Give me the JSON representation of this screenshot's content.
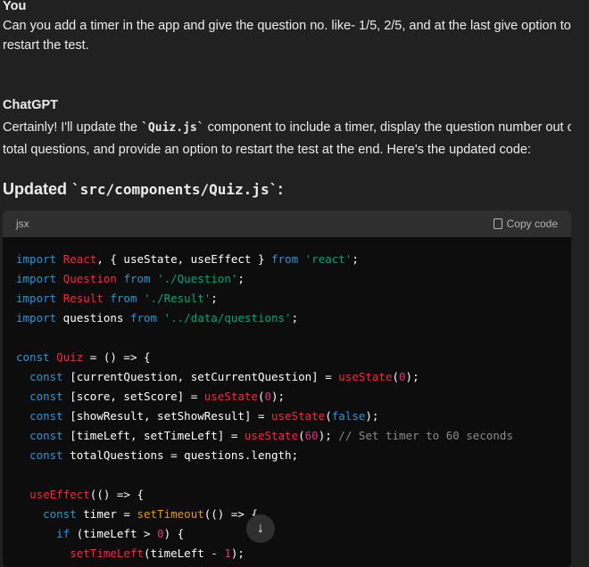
{
  "user": {
    "name": "You",
    "message": "Can you add a timer in the app and give the question no. like- 1/5, 2/5, and at the last give option to restart the test."
  },
  "assistant": {
    "name": "ChatGPT",
    "intro_before": "Certainly! I'll update the ",
    "intro_code": "`Quiz.js`",
    "intro_after": " component to include a timer, display the question number out of total questions, and provide an option to restart the test at the end. Here's the updated code:"
  },
  "heading": {
    "prefix": "Updated ",
    "code": "`src/components/Quiz.js`",
    "suffix": ":"
  },
  "codeblock": {
    "language": "jsx",
    "copy_label": "Copy code",
    "lines": [
      [
        [
          "import",
          "k"
        ],
        [
          " ",
          "p"
        ],
        [
          "React",
          "t"
        ],
        [
          ", { useState, useEffect } ",
          "p"
        ],
        [
          "from",
          "k"
        ],
        [
          " ",
          "p"
        ],
        [
          "'react'",
          "s"
        ],
        [
          ";",
          "p"
        ]
      ],
      [
        [
          "import",
          "k"
        ],
        [
          " ",
          "p"
        ],
        [
          "Question",
          "t"
        ],
        [
          " ",
          "p"
        ],
        [
          "from",
          "k"
        ],
        [
          " ",
          "p"
        ],
        [
          "'./Question'",
          "s"
        ],
        [
          ";",
          "p"
        ]
      ],
      [
        [
          "import",
          "k"
        ],
        [
          " ",
          "p"
        ],
        [
          "Result",
          "t"
        ],
        [
          " ",
          "p"
        ],
        [
          "from",
          "k"
        ],
        [
          " ",
          "p"
        ],
        [
          "'./Result'",
          "s"
        ],
        [
          ";",
          "p"
        ]
      ],
      [
        [
          "import",
          "k"
        ],
        [
          " questions ",
          "p"
        ],
        [
          "from",
          "k"
        ],
        [
          " ",
          "p"
        ],
        [
          "'../data/questions'",
          "s"
        ],
        [
          ";",
          "p"
        ]
      ],
      [],
      [
        [
          "const",
          "k"
        ],
        [
          " ",
          "p"
        ],
        [
          "Quiz",
          "t"
        ],
        [
          " = () => {",
          "p"
        ]
      ],
      [
        [
          "  ",
          "p"
        ],
        [
          "const",
          "k"
        ],
        [
          " [currentQuestion, setCurrentQuestion] = ",
          "p"
        ],
        [
          "useState",
          "t"
        ],
        [
          "(",
          "p"
        ],
        [
          "0",
          "n"
        ],
        [
          ");",
          "p"
        ]
      ],
      [
        [
          "  ",
          "p"
        ],
        [
          "const",
          "k"
        ],
        [
          " [score, setScore] = ",
          "p"
        ],
        [
          "useState",
          "t"
        ],
        [
          "(",
          "p"
        ],
        [
          "0",
          "n"
        ],
        [
          ");",
          "p"
        ]
      ],
      [
        [
          "  ",
          "p"
        ],
        [
          "const",
          "k"
        ],
        [
          " [showResult, setShowResult] = ",
          "p"
        ],
        [
          "useState",
          "t"
        ],
        [
          "(",
          "p"
        ],
        [
          "false",
          "k"
        ],
        [
          ");",
          "p"
        ]
      ],
      [
        [
          "  ",
          "p"
        ],
        [
          "const",
          "k"
        ],
        [
          " [timeLeft, setTimeLeft] = ",
          "p"
        ],
        [
          "useState",
          "t"
        ],
        [
          "(",
          "p"
        ],
        [
          "60",
          "n"
        ],
        [
          "); ",
          "p"
        ],
        [
          "// Set timer to 60 seconds",
          "c"
        ]
      ],
      [
        [
          "  ",
          "p"
        ],
        [
          "const",
          "k"
        ],
        [
          " totalQuestions = questions.length;",
          "p"
        ]
      ],
      [],
      [
        [
          "  ",
          "p"
        ],
        [
          "useEffect",
          "t"
        ],
        [
          "(() => {",
          "p"
        ]
      ],
      [
        [
          "    ",
          "p"
        ],
        [
          "const",
          "k"
        ],
        [
          " timer = ",
          "p"
        ],
        [
          "setTimeout",
          "f"
        ],
        [
          "(() => {",
          "p"
        ]
      ],
      [
        [
          "      ",
          "p"
        ],
        [
          "if",
          "k"
        ],
        [
          " (timeLeft > ",
          "p"
        ],
        [
          "0",
          "n"
        ],
        [
          ") {",
          "p"
        ]
      ],
      [
        [
          "        ",
          "p"
        ],
        [
          "setTimeLeft",
          "t"
        ],
        [
          "(timeLeft - ",
          "p"
        ],
        [
          "1",
          "n"
        ],
        [
          ");",
          "p"
        ]
      ]
    ]
  }
}
